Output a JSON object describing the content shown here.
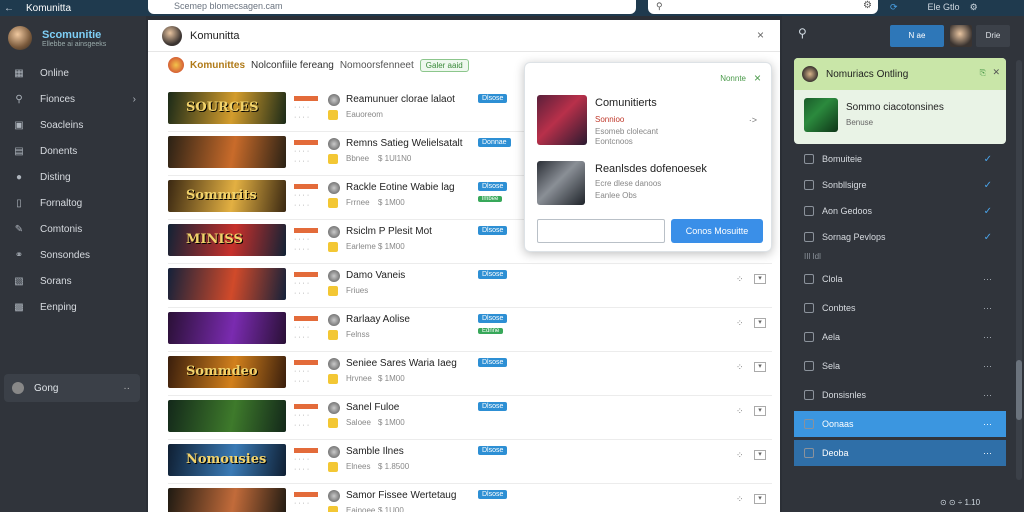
{
  "topbar": {
    "back_icon": "←",
    "app_title": "Komunitta",
    "url": "Scemep blomecsagen.cam",
    "right_label": "Ele Gtlo"
  },
  "left": {
    "brand_name": "Scomunitie",
    "brand_sub": "Ellebbe ai ainsgeeks",
    "items": [
      {
        "label": "Online",
        "icon": "grid-icon",
        "glyph": "▦"
      },
      {
        "label": "Fionces",
        "icon": "search-icon",
        "glyph": "⚲",
        "chevron": "›"
      },
      {
        "label": "Soacleins",
        "icon": "window-icon",
        "glyph": "▣"
      },
      {
        "label": "Donents",
        "icon": "list-icon",
        "glyph": "▤"
      },
      {
        "label": "Disting",
        "icon": "record-icon",
        "glyph": "●"
      },
      {
        "label": "Fornaltog",
        "icon": "tablet-icon",
        "glyph": "▯"
      },
      {
        "label": "Comtonis",
        "icon": "pin-icon",
        "glyph": "✎"
      },
      {
        "label": "Sonsondes",
        "icon": "link-icon",
        "glyph": "⚭"
      },
      {
        "label": "Sorans",
        "icon": "image-icon",
        "glyph": "▧"
      },
      {
        "label": "Eenping",
        "icon": "lock-icon",
        "glyph": "▩"
      }
    ],
    "footer_label": "Gong",
    "footer_more": "··"
  },
  "main": {
    "title": "Komunitta",
    "close": "×",
    "site_name": "Komunittes",
    "site_desc": "Nolconfiile fereang",
    "site_desc2": "Nomoorsfenneet",
    "site_badge": "Galer aaid",
    "rows": [
      {
        "thumb_title": "SOURCES",
        "c1": "#1b2a18",
        "c2": "#d39c2c",
        "name": "Reamunuer clorae lalaot",
        "sub1": "Eauoreom",
        "sub2": "",
        "chip": "Dlsose",
        "chip2": ""
      },
      {
        "thumb_title": "",
        "c1": "#2a2115",
        "c2": "#c96b2a",
        "name": "Remns Satieg Welielsatalt",
        "sub1": "Bbnee",
        "sub2": "$ 1Ul1N0",
        "chip": "Donnae",
        "chip2": ""
      },
      {
        "thumb_title": "Sommrits",
        "c1": "#3a2812",
        "c2": "#e3b042",
        "name": "Rackle Eotine Wabie lag",
        "sub1": "Frrnee",
        "sub2": "$ 1M00",
        "chip": "Dlsose",
        "chip2": "lmbee"
      },
      {
        "thumb_title": "MINISS",
        "c1": "#122235",
        "c2": "#c7302b",
        "name": "Rsiclm P Plesit Mot",
        "sub1": "Earleme",
        "sub2": "$ 1M00",
        "chip": "Dlsose",
        "chip2": ""
      },
      {
        "thumb_title": "",
        "c1": "#14213a",
        "c2": "#d14a2a",
        "name": "Damo Vaneis",
        "sub1": "Friues",
        "sub2": "",
        "chip": "Dlsose",
        "chip2": ""
      },
      {
        "thumb_title": "",
        "c1": "#2a1036",
        "c2": "#7a2bb0",
        "name": "Rarlaay Aolise",
        "sub1": "Felnss",
        "sub2": "",
        "chip": "Dlsose",
        "chip2": "Ednne"
      },
      {
        "thumb_title": "Sommdeo",
        "c1": "#3a1e0c",
        "c2": "#d2801c",
        "name": "Seniee Sares Waria Iaeg",
        "sub1": "Hrvnee",
        "sub2": "$ 1M00",
        "chip": "Dlsose",
        "chip2": ""
      },
      {
        "thumb_title": "",
        "c1": "#13281a",
        "c2": "#3e7a2b",
        "name": "Sanel Fuloe",
        "sub1": "Saloee",
        "sub2": "$ 1M00",
        "chip": "Dlsose",
        "chip2": ""
      },
      {
        "thumb_title": "Nomousies",
        "c1": "#0f1f33",
        "c2": "#3a7ab5",
        "name": "Samble Ilnes",
        "sub1": "Elnees",
        "sub2": "$ 1.8500",
        "chip": "Dlsose",
        "chip2": ""
      },
      {
        "thumb_title": "",
        "c1": "#1f1a12",
        "c2": "#c26b3a",
        "name": "Samor Fissee Wertetaug",
        "sub1": "Eainoee",
        "sub2": "$ 1U00",
        "chip": "Dlsose",
        "chip2": ""
      }
    ]
  },
  "popup": {
    "head_mark": "Nonnte",
    "close": "×",
    "items": [
      {
        "title": "Comunitierts",
        "l1": "Sonnioo",
        "l2": "Esomeb clolecant",
        "l3": "Eontcnoos",
        "arrow": "·>"
      },
      {
        "title": "Reanlsdes dofenoesek",
        "l1": "",
        "l2": "Ecre dlese danoos",
        "l3": "Eanlee Obs",
        "arrow": ""
      }
    ],
    "button": "Conos Mosuitte"
  },
  "right": {
    "search_icon": "⚲",
    "btn1": "N ae",
    "btn2": "Drie",
    "card_title": "Nomuriacs Ontling",
    "card_line1": "Sommo ciacotonsines",
    "card_line2": "Benuse",
    "items": [
      {
        "label": "Bomuiteie",
        "mark": "✓"
      },
      {
        "label": "Sonbllsigre",
        "mark": "✓"
      },
      {
        "label": "Aon Gedoos",
        "mark": "✓"
      },
      {
        "label": "Sornag Pevlops",
        "mark": "✓"
      }
    ],
    "section_label": "IIl Idl",
    "items2": [
      {
        "label": "Clola",
        "mark": "···"
      },
      {
        "label": "Conbtes",
        "mark": "···"
      },
      {
        "label": "Aela",
        "mark": "···"
      },
      {
        "label": "Sela",
        "mark": "···"
      },
      {
        "label": "Donsisnles",
        "mark": "···"
      },
      {
        "label": "Oonaas",
        "mark": "···"
      },
      {
        "label": "Deoba",
        "mark": "···"
      }
    ],
    "footer": "⊙ ⊙  ÷ 1.10"
  }
}
